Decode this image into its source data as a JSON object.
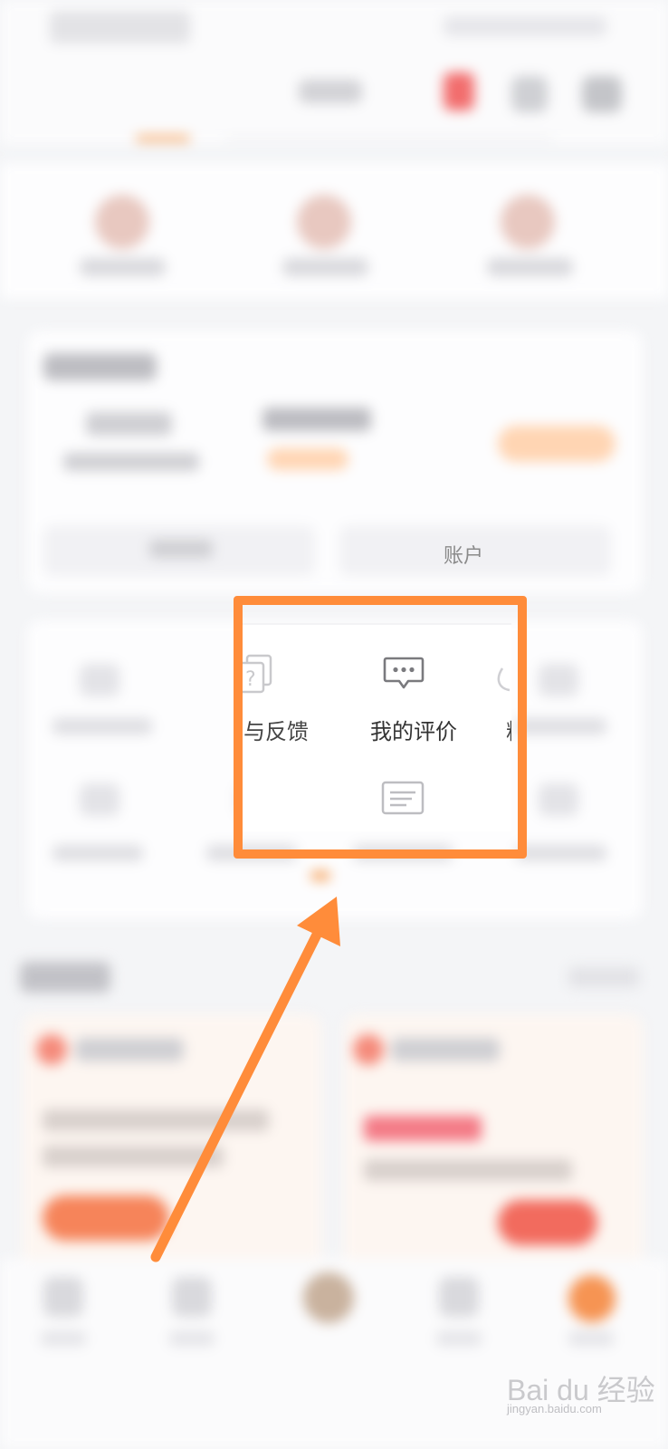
{
  "account_section": {
    "tab_right_fragment": "账户"
  },
  "services": {
    "help_label_fragment": "与反馈",
    "review_label": "我的评价",
    "fans_label_fragment": "粉丝"
  },
  "icons": {
    "help": "question-doc-icon",
    "review": "speech-bubble-icon",
    "note": "note-card-icon",
    "fans": "person-icon"
  },
  "annotation": {
    "highlight_color": "#ff8c3a",
    "arrow_color": "#ff8c3a"
  },
  "watermark": {
    "main": "Bai du 经验",
    "sub": "jingyan.baidu.com"
  }
}
